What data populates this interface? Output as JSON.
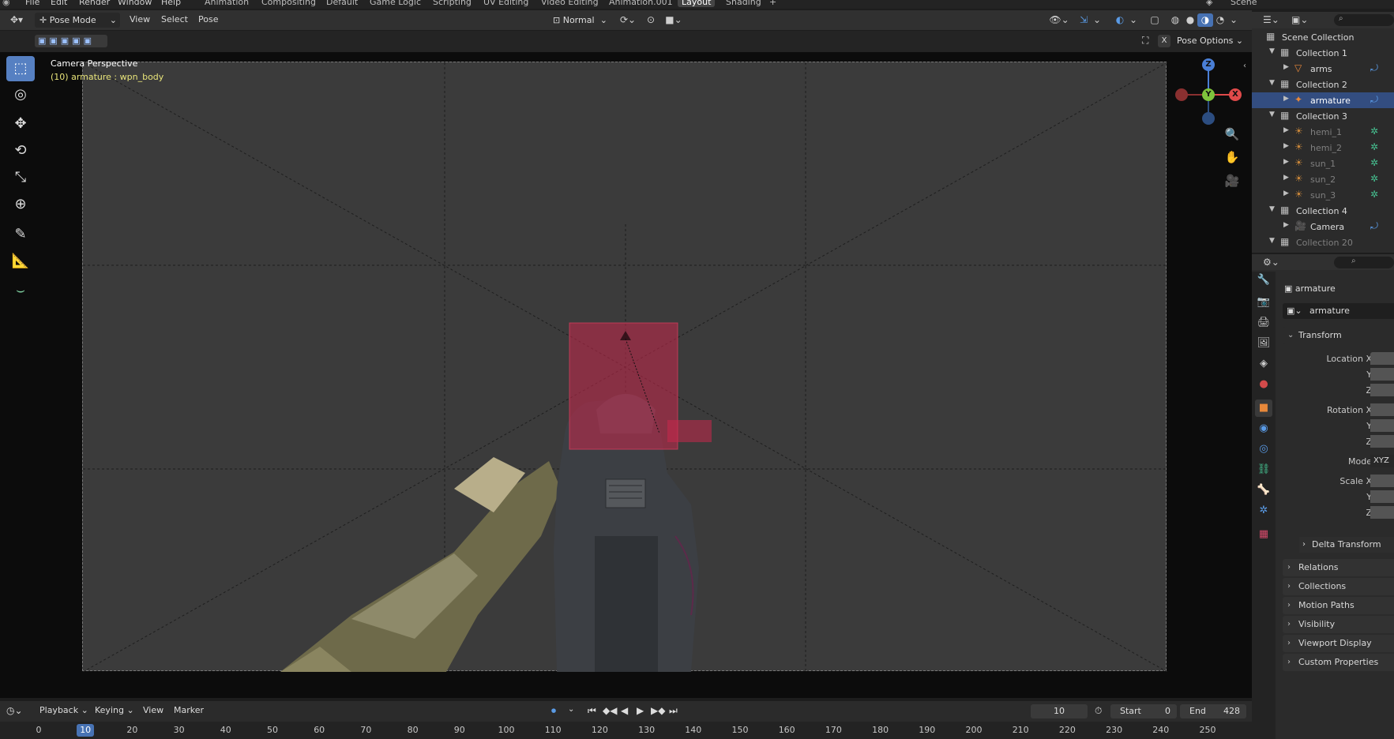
{
  "topbar": {
    "menus": [
      "File",
      "Edit",
      "Render",
      "Window",
      "Help"
    ],
    "workspaces": [
      "Animation",
      "Compositing",
      "Default",
      "Game Logic",
      "Scripting",
      "UV Editing",
      "Video Editing",
      "Animation.001",
      "Layout",
      "Shading"
    ],
    "active_workspace": "Layout",
    "add_tab": "+",
    "scene_name": "Scene"
  },
  "viewport_header": {
    "mode": "Pose Mode",
    "menus": [
      "View",
      "Select",
      "Pose"
    ],
    "orientation": "Normal",
    "pose_options": "Pose Options",
    "close_x": "X"
  },
  "viewport": {
    "camera_label": "Camera Perspective",
    "object_label": "(10) armature : wpn_body",
    "gizmo": {
      "z": "Z",
      "y": "Y",
      "x": "X"
    }
  },
  "timeline": {
    "menus": [
      "Playback",
      "Keying",
      "View",
      "Marker"
    ],
    "current_frame": "10",
    "start_label": "Start",
    "start_value": "0",
    "end_label": "End",
    "end_value": "428",
    "ruler_ticks": [
      "0",
      "10",
      "20",
      "30",
      "40",
      "50",
      "60",
      "70",
      "80",
      "90",
      "100",
      "110",
      "120",
      "130",
      "140",
      "150",
      "160",
      "170",
      "180",
      "190",
      "200",
      "210",
      "220",
      "230",
      "240",
      "250"
    ],
    "current_tick": "10"
  },
  "outliner": {
    "rows": [
      {
        "label": "Scene Collection",
        "kind": "scene",
        "depth": 0,
        "selected": false,
        "dim": false
      },
      {
        "label": "Collection 1",
        "kind": "collection",
        "depth": 1,
        "selected": false,
        "dim": false
      },
      {
        "label": "arms",
        "kind": "mesh",
        "depth": 2,
        "selected": false,
        "dim": false
      },
      {
        "label": "Collection 2",
        "kind": "collection",
        "depth": 1,
        "selected": false,
        "dim": false
      },
      {
        "label": "armature",
        "kind": "armature",
        "depth": 2,
        "selected": true,
        "dim": false
      },
      {
        "label": "Collection 3",
        "kind": "collection",
        "depth": 1,
        "selected": false,
        "dim": false
      },
      {
        "label": "hemi_1",
        "kind": "light",
        "depth": 2,
        "selected": false,
        "dim": true
      },
      {
        "label": "hemi_2",
        "kind": "light",
        "depth": 2,
        "selected": false,
        "dim": true
      },
      {
        "label": "sun_1",
        "kind": "light",
        "depth": 2,
        "selected": false,
        "dim": true
      },
      {
        "label": "sun_2",
        "kind": "light",
        "depth": 2,
        "selected": false,
        "dim": true
      },
      {
        "label": "sun_3",
        "kind": "light",
        "depth": 2,
        "selected": false,
        "dim": true
      },
      {
        "label": "Collection 4",
        "kind": "collection",
        "depth": 1,
        "selected": false,
        "dim": false
      },
      {
        "label": "Camera",
        "kind": "camera",
        "depth": 2,
        "selected": false,
        "dim": false
      },
      {
        "label": "Collection 20",
        "kind": "collection",
        "depth": 1,
        "selected": false,
        "dim": true
      }
    ]
  },
  "properties": {
    "object_name": "armature",
    "datablock": "armature",
    "transform_title": "Transform",
    "location_label": "Location X",
    "rotation_label": "Rotation X",
    "scale_label": "Scale X",
    "y_label": "Y",
    "z_label": "Z",
    "mode_label": "Mode",
    "mode_value": "XYZ",
    "delta_transform": "Delta Transform",
    "sections": [
      "Relations",
      "Collections",
      "Motion Paths",
      "Visibility",
      "Viewport Display",
      "Custom Properties"
    ]
  },
  "colors": {
    "accent": "#4772b3",
    "selection": "#334d80",
    "bone_overlay": "#c8284c",
    "object_label": "#e8e47a",
    "gizmo_x": "#e04a4a",
    "gizmo_y": "#7ec33c",
    "gizmo_z": "#4a7fd6"
  }
}
